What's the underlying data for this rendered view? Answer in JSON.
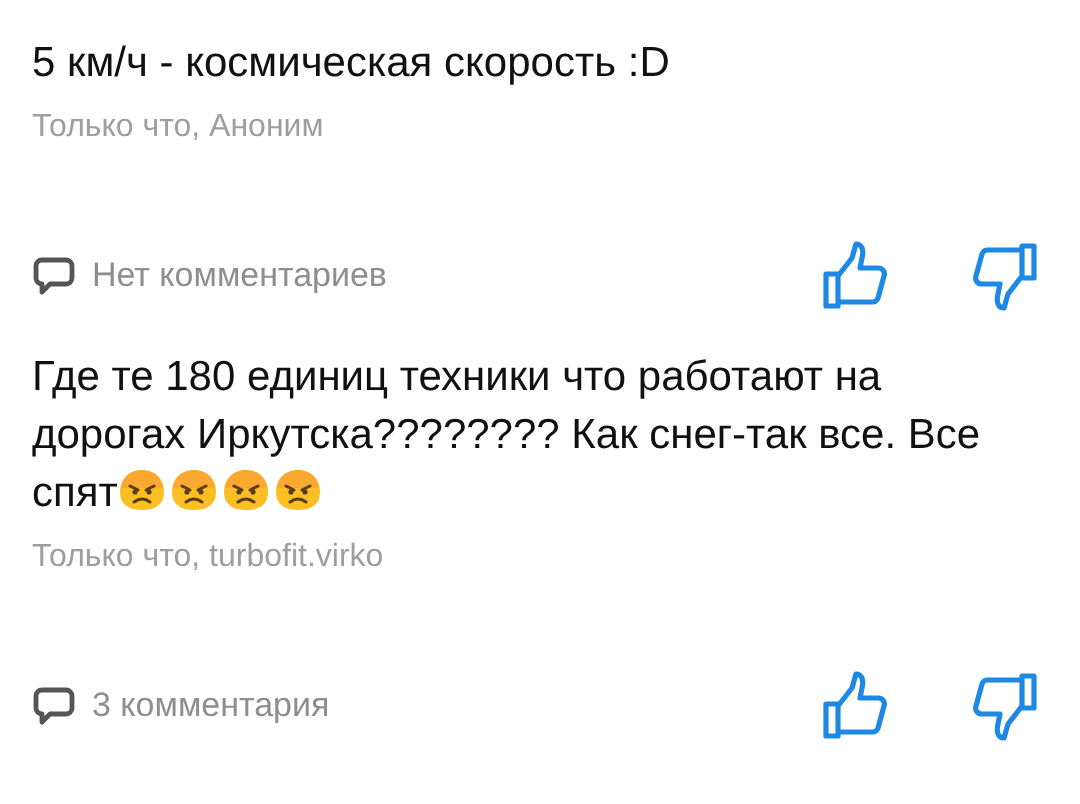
{
  "posts": [
    {
      "text": "5 км/ч - космическая скорость :D",
      "meta": "Только что, Аноним",
      "comments": "Нет комментариев"
    },
    {
      "text": "Где те 180 единиц техники что работают на дорогах Иркутска???????? Как снег-так все. Все спят",
      "emojis": [
        {
          "kind": "frowning"
        },
        {
          "kind": "frowning"
        },
        {
          "kind": "frowning"
        },
        {
          "kind": "frowning"
        }
      ],
      "meta": "Только что, turbofit.virko",
      "comments": "3 комментария"
    }
  ]
}
